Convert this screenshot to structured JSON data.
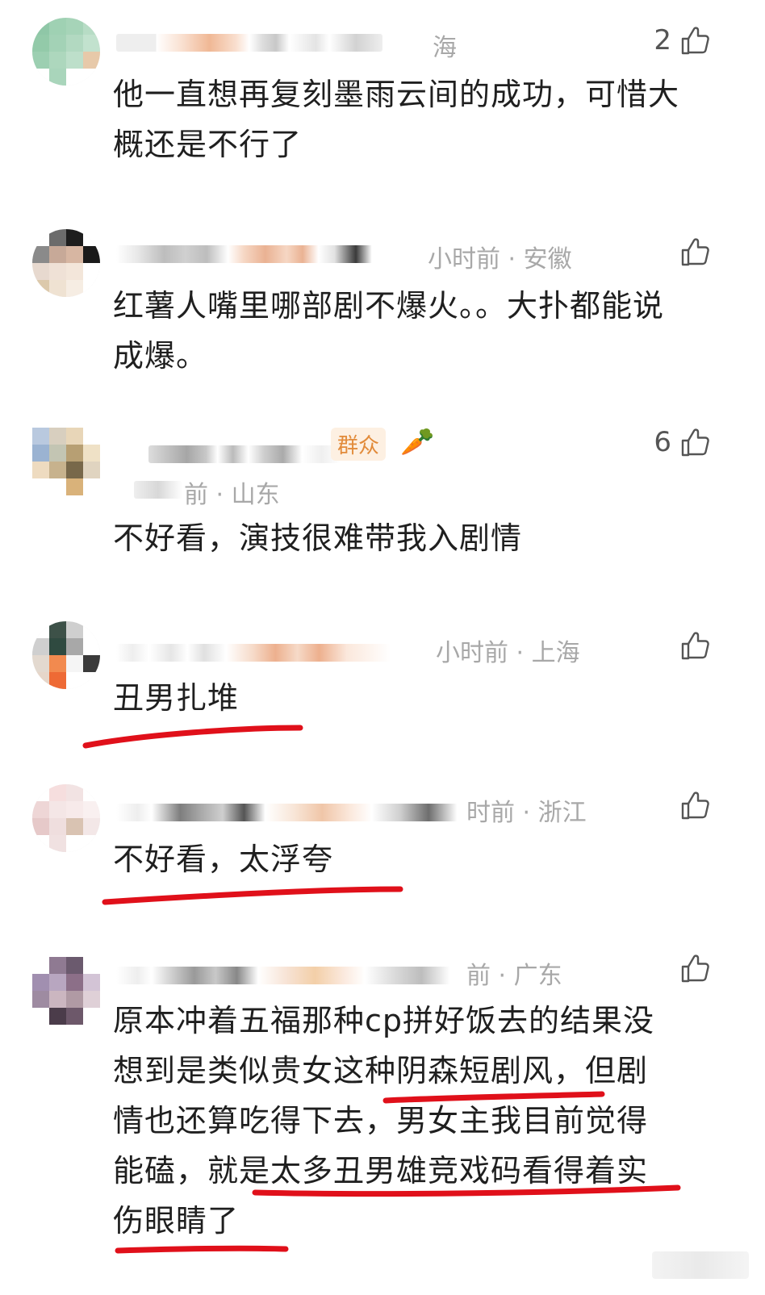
{
  "comments": [
    {
      "meta": "海",
      "likes": "2",
      "content": "他一直想再复刻墨雨云间的成功，可惜大概还是不行了"
    },
    {
      "meta": "小时前 · 安徽",
      "likes": "",
      "content": "红薯人嘴里哪部剧不爆火。。大扑都能说成爆。"
    },
    {
      "meta": "前 · 山东",
      "badge": "群众",
      "likes": "6",
      "content": "不好看，演技很难带我入剧情"
    },
    {
      "meta": "小时前 · 上海",
      "likes": "",
      "content": "丑男扎堆"
    },
    {
      "meta": "时前 · 浙江",
      "likes": "",
      "content": "不好看，太浮夸"
    },
    {
      "meta": "前 · 广东",
      "likes": "",
      "content_lines": [
        "原本冲着五福那种cp拼好饭去的结果没",
        "想到是类似贵女这种阴森短剧风，但剧",
        "情也还算吃得下去，男女主我目前觉得",
        "能磕，就是太多丑男雄竞戏码看得着实",
        "伤眼睛了"
      ]
    }
  ],
  "colors": {
    "underline": "#e0101a",
    "meta": "#a8a8a8",
    "text": "#1f1f1f"
  },
  "icons": {
    "like": "thumbs-up-icon"
  }
}
